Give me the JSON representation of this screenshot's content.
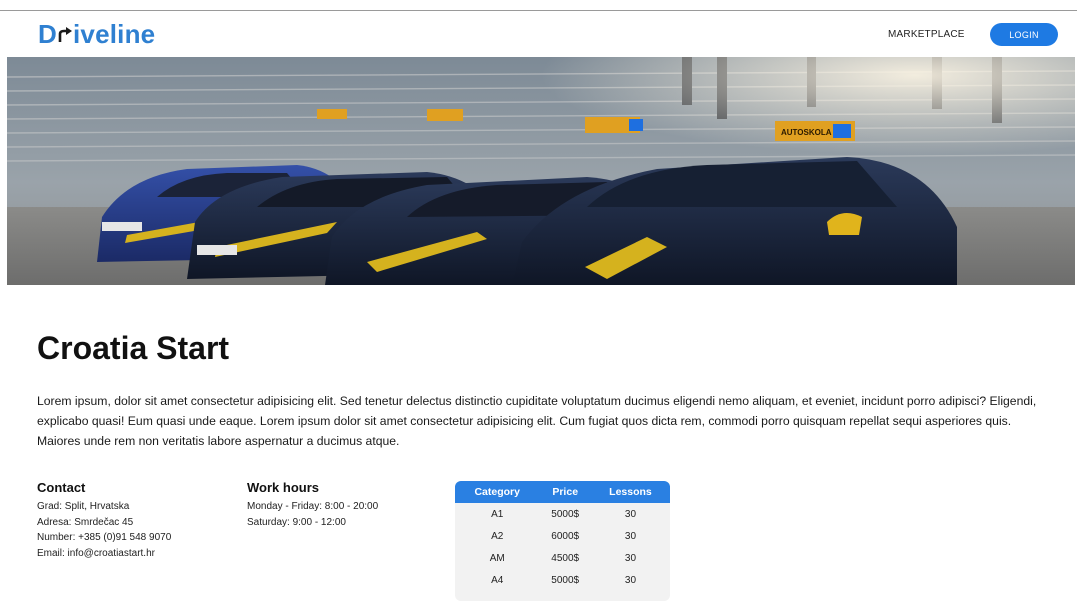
{
  "brand": {
    "name_prefix": "D",
    "name_suffix": "iveline"
  },
  "nav": {
    "marketplace": "MARKETPLACE",
    "login": "LOGIN"
  },
  "hero": {
    "image": "driving-school-cars-photo",
    "sign_text": "AUTOSKOLA"
  },
  "page": {
    "title": "Croatia Start",
    "description": "Lorem ipsum, dolor sit amet consectetur adipisicing elit. Sed tenetur delectus distinctio cupiditate voluptatum ducimus eligendi nemo aliquam, et eveniet, incidunt porro adipisci? Eligendi, explicabo quasi! Eum quasi unde eaque. Lorem ipsum dolor sit amet consectetur adipisicing elit. Cum fugiat quos dicta rem, commodi porro quisquam repellat sequi asperiores quis. Maiores unde rem non veritatis labore aspernatur a ducimus atque."
  },
  "contact": {
    "heading": "Contact",
    "lines": [
      "Grad: Split, Hrvatska",
      "Adresa: Smrdečac 45",
      "Number: +385 (0)91 548 9070",
      "Email: info@croatiastart.hr"
    ]
  },
  "work_hours": {
    "heading": "Work hours",
    "lines": [
      "Monday - Friday: 8:00 - 20:00",
      "Saturday: 9:00 - 12:00"
    ]
  },
  "prices": {
    "headers": [
      "Category",
      "Price",
      "Lessons"
    ],
    "rows": [
      [
        "A1",
        "5000$",
        "30"
      ],
      [
        "A2",
        "6000$",
        "30"
      ],
      [
        "AM",
        "4500$",
        "30"
      ],
      [
        "A4",
        "5000$",
        "30"
      ]
    ]
  },
  "colors": {
    "brand": "#2f80d1",
    "accent": "#1e7ae3",
    "table_header": "#2a80e2"
  }
}
